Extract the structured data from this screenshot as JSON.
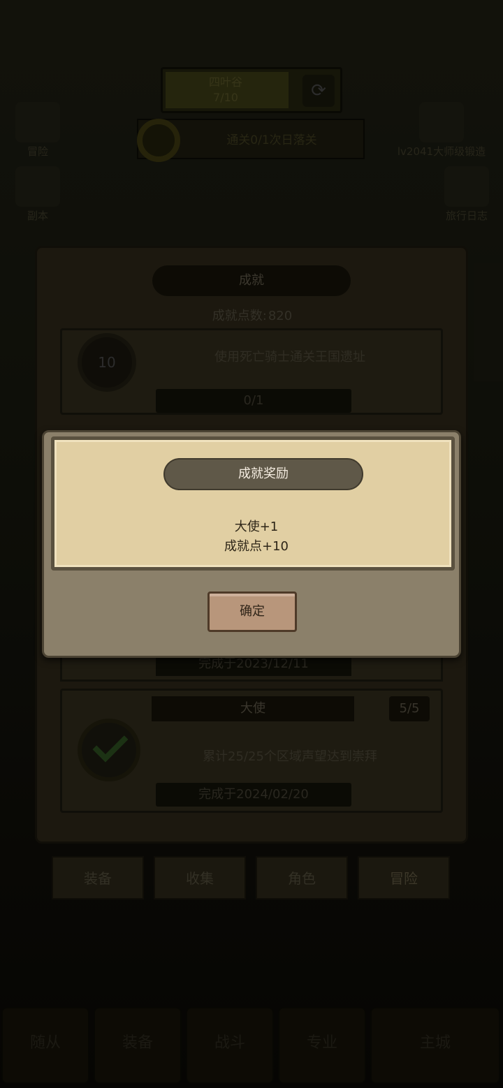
{
  "hud": {
    "progress_label": "四叶谷",
    "progress_value": "7/10",
    "quest_text": "通关0/1次日落关",
    "side_left_top": "冒险",
    "side_left_mid": "副本",
    "side_right_top": "lv2041大师级锻造",
    "side_right_mid": "旅行日志"
  },
  "achievements": {
    "title": "成就",
    "points_label": "成就点数:",
    "points_value": "820",
    "card_a": {
      "medal": "10",
      "desc": "使用死亡骑士通关王国遗址",
      "progress": "0/1"
    },
    "done_date_1": "完成于2023/12/11",
    "card_b": {
      "title": "大使",
      "count": "5/5",
      "desc": "累计25/25个区域声望达到崇拜",
      "date": "完成于2024/02/20"
    }
  },
  "categories": [
    "装备",
    "收集",
    "角色",
    "冒险"
  ],
  "bottom_nav": [
    "随从",
    "装备",
    "战斗",
    "专业",
    "主城"
  ],
  "modal": {
    "title": "成就奖励",
    "reward_1": "大使+1",
    "reward_2": "成就点+10",
    "confirm": "确定"
  }
}
